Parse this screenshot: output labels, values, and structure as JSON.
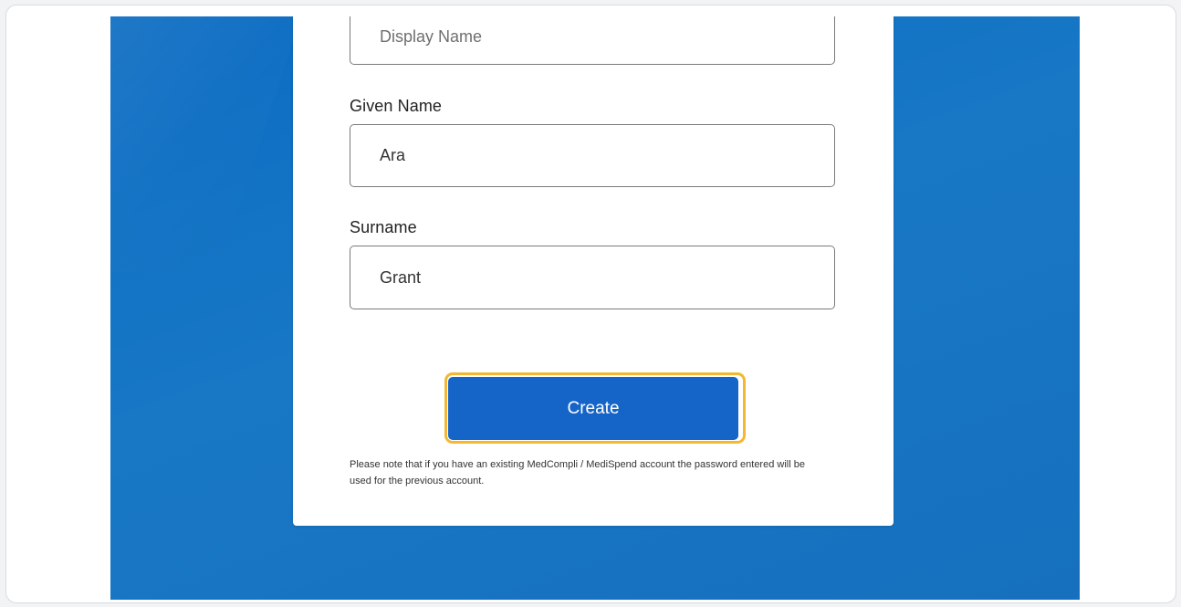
{
  "form": {
    "display_name": {
      "placeholder": "Display Name",
      "value": ""
    },
    "given_name": {
      "label": "Given Name",
      "value": "Ara"
    },
    "surname": {
      "label": "Surname",
      "value": "Grant"
    },
    "create_label": "Create",
    "note": "Please note that if you have an existing MedCompli / MediSpend account the password entered will be used for the previous account."
  },
  "colors": {
    "background_blue": "#1878c6",
    "button_blue": "#1565c8",
    "highlight_ring": "#f4b731"
  }
}
